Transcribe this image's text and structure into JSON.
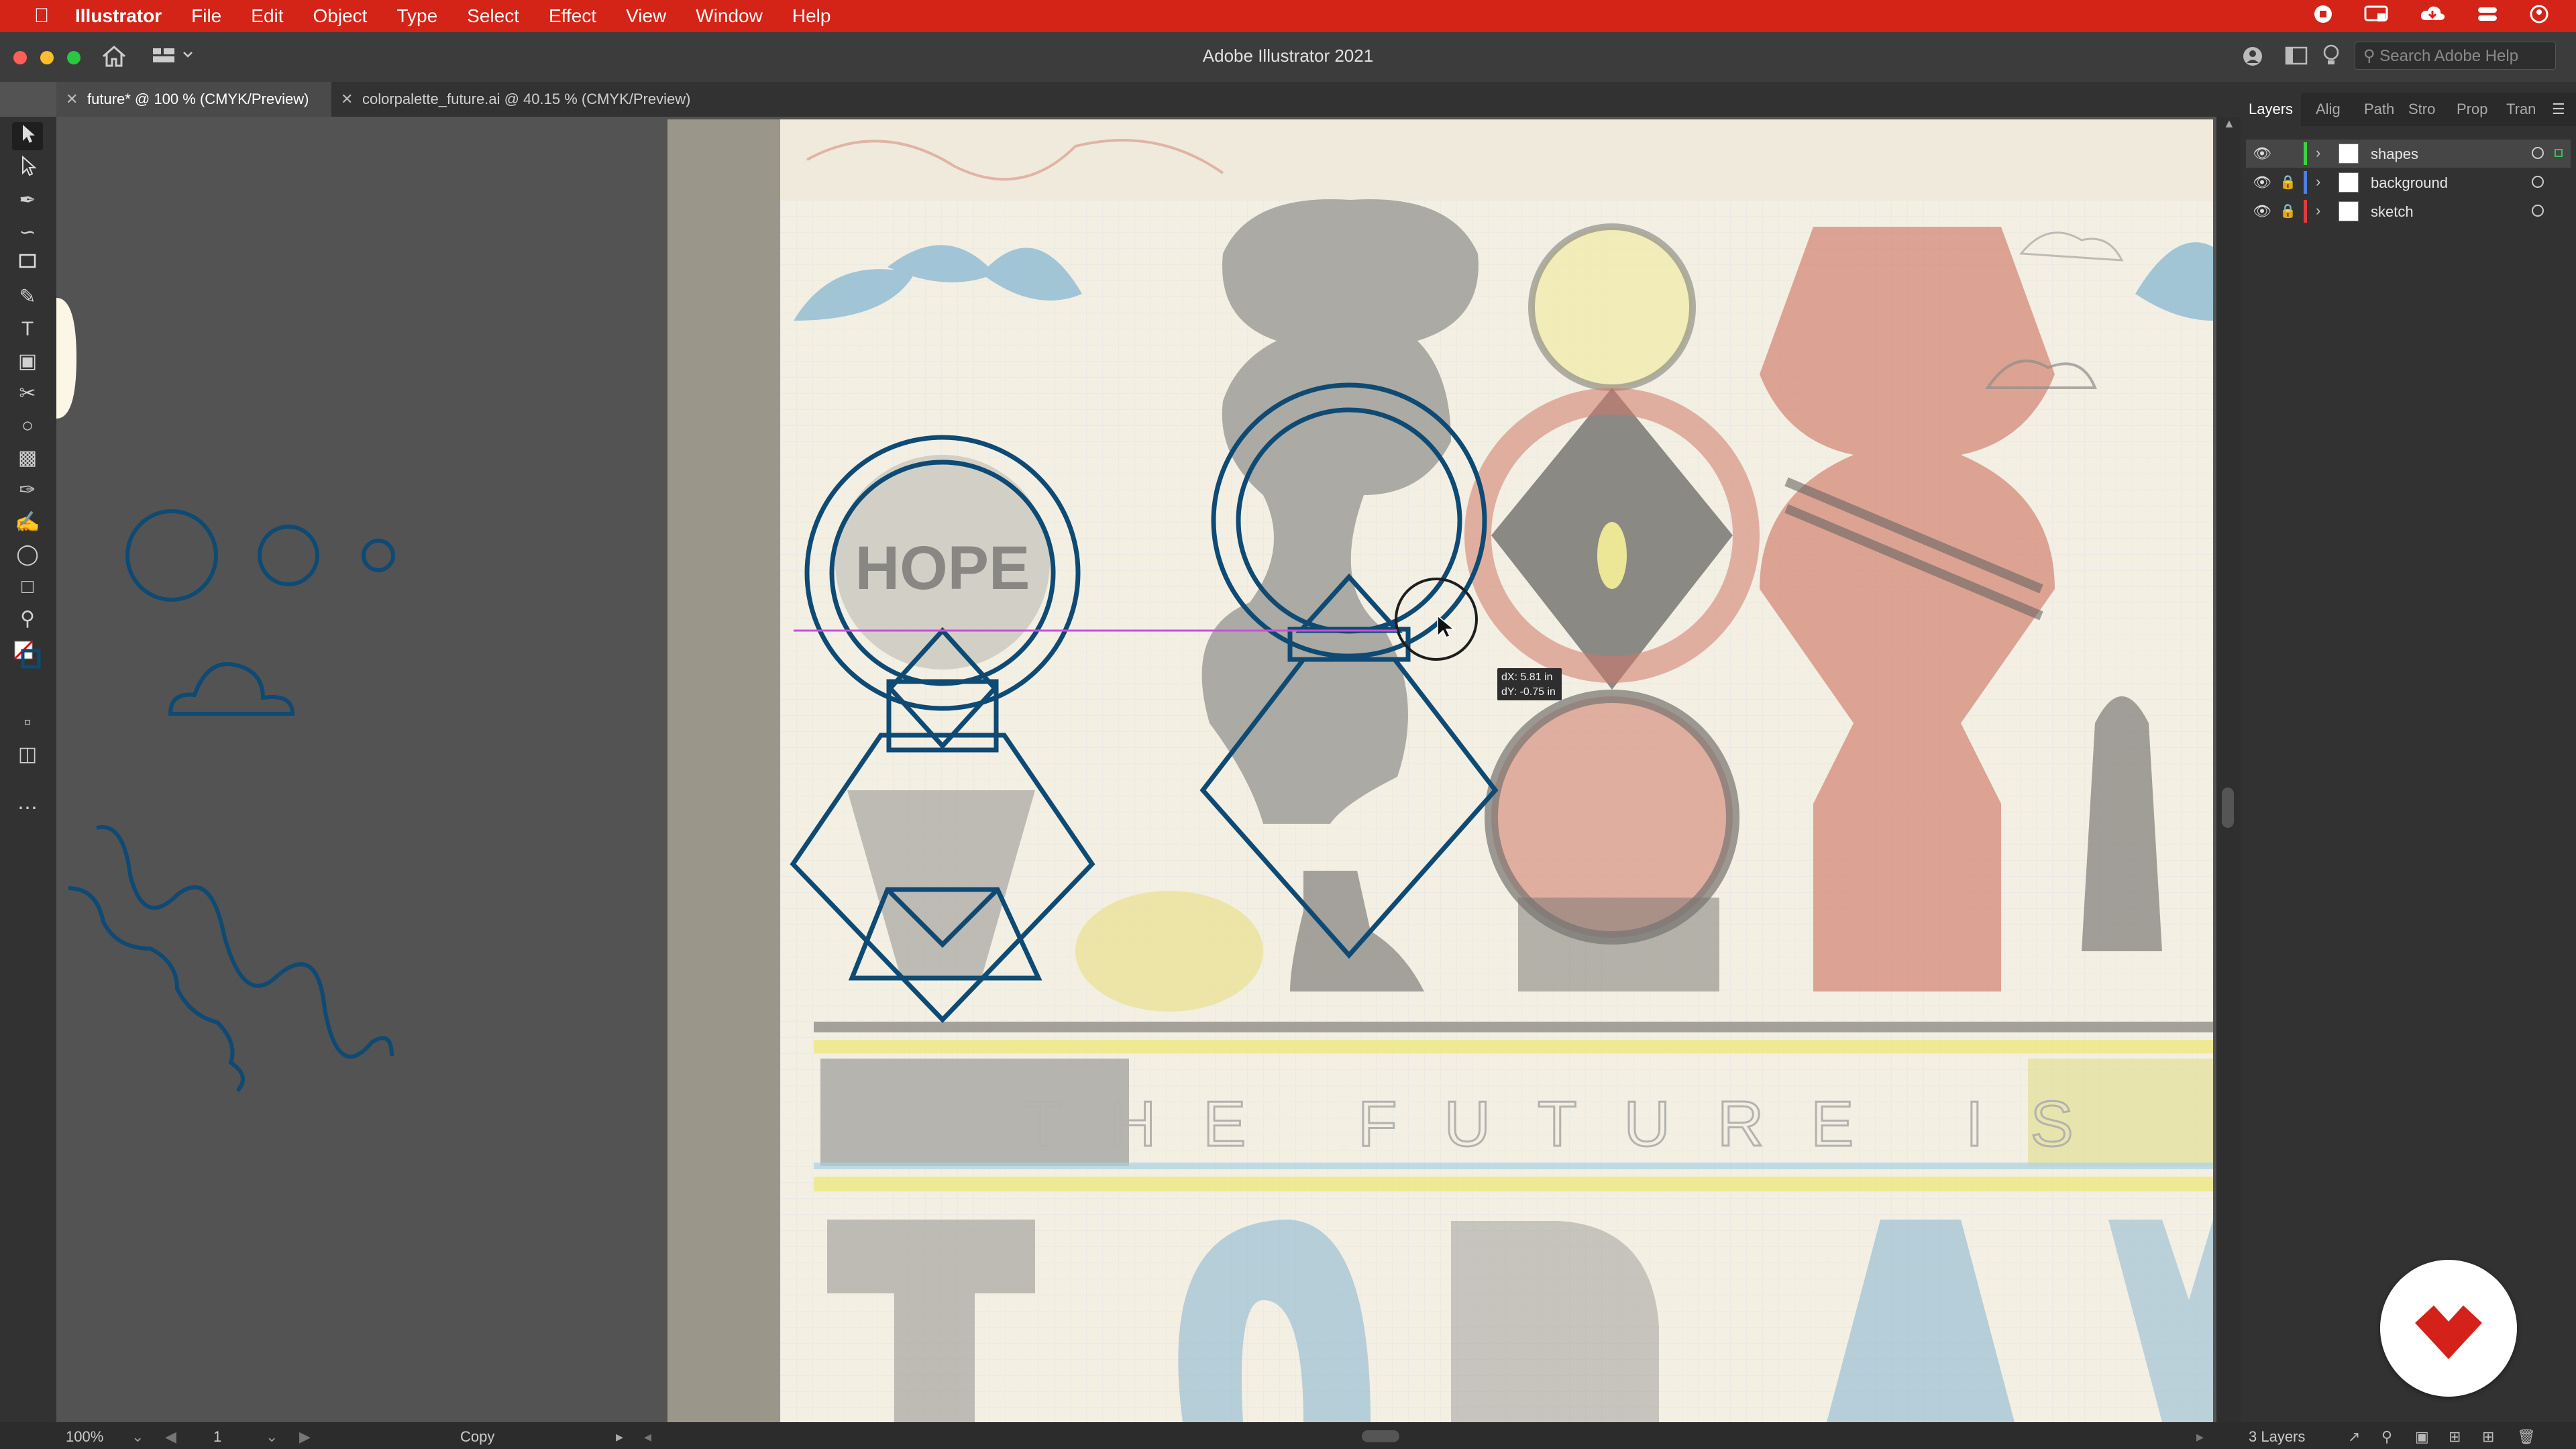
{
  "menubar": {
    "app": "Illustrator",
    "items": [
      "File",
      "Edit",
      "Object",
      "Type",
      "Select",
      "Effect",
      "View",
      "Window",
      "Help"
    ]
  },
  "window": {
    "title": "Adobe Illustrator 2021",
    "help_search_placeholder": "Search Adobe Help"
  },
  "tabs": [
    {
      "label": "future* @ 100 % (CMYK/Preview)",
      "active": true
    },
    {
      "label": "colorpalette_future.ai @ 40.15 % (CMYK/Preview)",
      "active": false
    }
  ],
  "layers_panel": {
    "tabs": [
      "Layers",
      "Alig",
      "Path",
      "Stro",
      "Prop",
      "Tran"
    ],
    "layers": [
      {
        "name": "shapes",
        "color": "#3ed23e",
        "locked": false,
        "selected": true
      },
      {
        "name": "background",
        "color": "#4f7fe3",
        "locked": true,
        "selected": false
      },
      {
        "name": "sketch",
        "color": "#e23b3b",
        "locked": true,
        "selected": false
      }
    ],
    "count": "3 Layers"
  },
  "artboard": {
    "hope_text": "HOPE",
    "banner_text": "THE FUTURE IS",
    "stroke_color": "#0e4a73",
    "guide_color": "#c84fd8"
  },
  "measure": {
    "dx": "dX: 5.81 in",
    "dy": "dY: -0.75 in"
  },
  "statusbar": {
    "zoom": "100%",
    "artboard_num": "1",
    "tool_status": "Copy"
  }
}
